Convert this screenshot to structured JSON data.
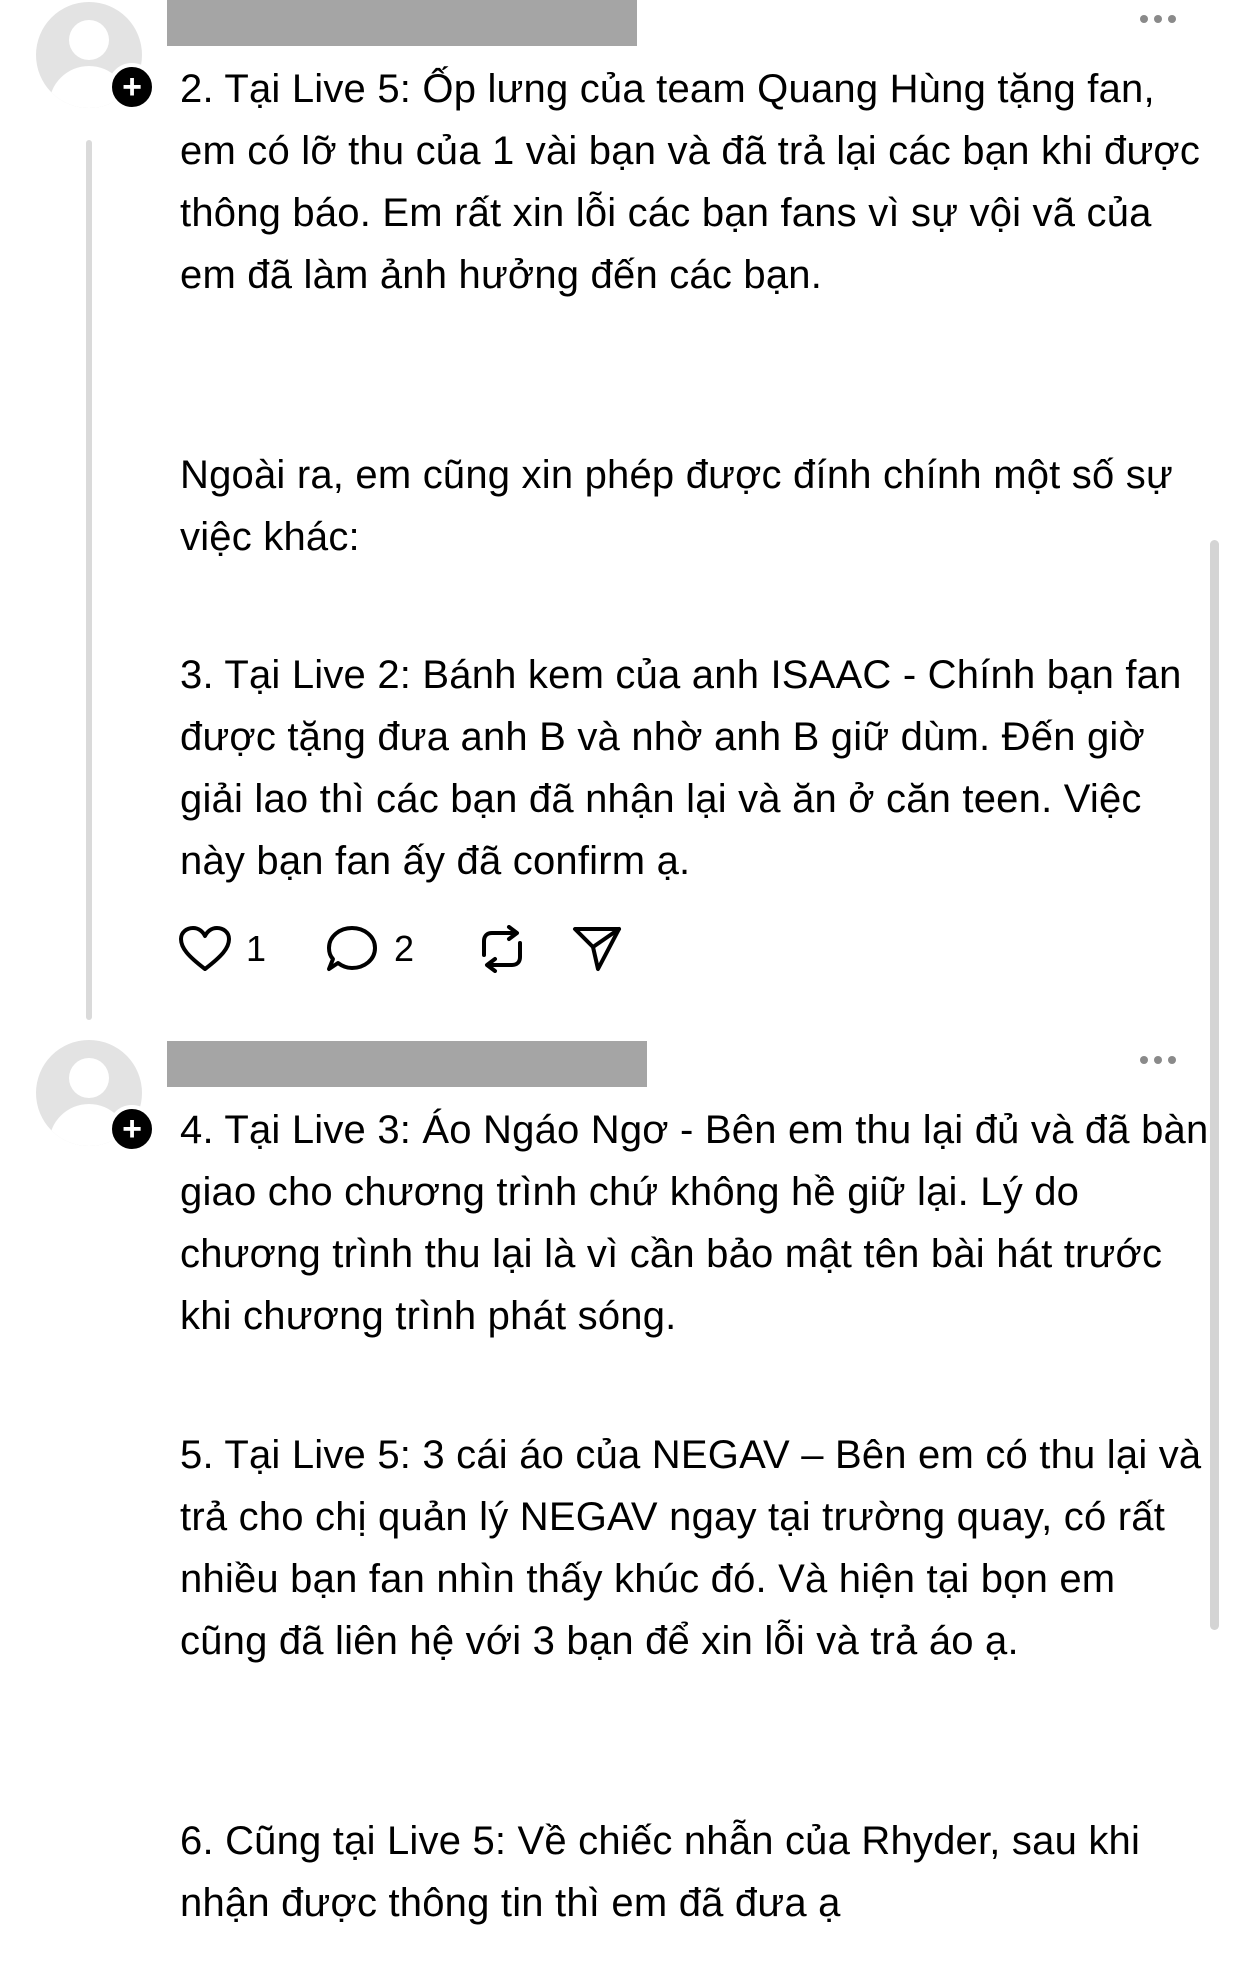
{
  "posts": [
    {
      "paragraphs": [
        "2. Tại Live 5: Ốp lưng của team Quang Hùng tặng fan, em có lỡ thu của 1 vài bạn và đã trả lại các bạn khi được thông báo. Em rất xin lỗi các bạn fans vì sự vội vã của em đã làm ảnh hưởng đến các bạn.",
        "Ngoài ra, em cũng xin phép được đính chính một số sự việc khác:",
        "3. Tại Live 2: Bánh kem của anh ISAAC - Chính bạn fan được tặng đưa anh B và nhờ anh B giữ dùm. Đến giờ giải lao thì các bạn đã nhận lại và ăn ở căn teen. Việc này bạn fan ấy đã confirm ạ."
      ],
      "actions": {
        "like_icon": "heart-icon",
        "like_count": "1",
        "reply_icon": "comment-icon",
        "reply_count": "2",
        "repost_icon": "repost-icon",
        "share_icon": "send-icon"
      }
    },
    {
      "paragraphs": [
        "4. Tại Live 3: Áo Ngáo Ngơ - Bên em thu lại đủ và đã bàn giao cho chương trình chứ không hề giữ lại. Lý do chương trình thu lại là vì cần bảo mật tên bài hát trước khi chương trình phát sóng.",
        "5. Tại Live 5: 3 cái áo của NEGAV – Bên em có thu lại và trả cho chị quản lý NEGAV ngay tại trường quay, có rất nhiều bạn fan nhìn thấy khúc đó. Và hiện tại bọn em cũng đã liên hệ với 3 bạn để xin lỗi và trả áo ạ.",
        "6. Cũng tại Live 5: Về chiếc nhẫn của Rhyder, sau khi nhận được thông tin thì em đã đưa ạ"
      ]
    }
  ],
  "icons": {
    "avatar": "avatar-placeholder-icon",
    "follow": "plus-icon",
    "menu": "more-icon"
  },
  "colors": {
    "text": "#000000",
    "redaction": "#a5a5a5",
    "avatar_bg": "#e3e3e3",
    "thread_line": "#dadada",
    "menu_dots": "#8a8a8a"
  }
}
